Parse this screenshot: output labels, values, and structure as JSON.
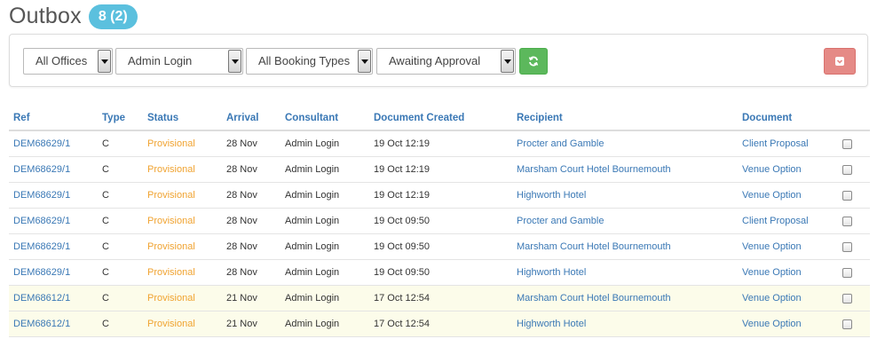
{
  "header": {
    "title": "Outbox",
    "count_badge": "8 (2)"
  },
  "filters": {
    "office": "All Offices",
    "user": "Admin Login",
    "booking_type": "All Booking Types",
    "status": "Awaiting Approval"
  },
  "icons": {
    "refresh": "refresh-icon",
    "export": "archive-download-icon"
  },
  "colors": {
    "badge": "#5bc0de",
    "refresh_button": "#5cb85c",
    "export_button": "#e58a86",
    "link": "#3a78b5",
    "status_provisional": "#f0a330",
    "highlight_row": "#fcfcea"
  },
  "table": {
    "columns": [
      "Ref",
      "Type",
      "Status",
      "Arrival",
      "Consultant",
      "Document Created",
      "Recipient",
      "Document"
    ],
    "rows": [
      {
        "ref": "DEM68629/1",
        "type": "C",
        "status": "Provisional",
        "arrival": "28 Nov",
        "consultant": "Admin Login",
        "created": "19 Oct 12:19",
        "recipient": "Procter and Gamble",
        "document": "Client Proposal",
        "checked": false,
        "highlight": false
      },
      {
        "ref": "DEM68629/1",
        "type": "C",
        "status": "Provisional",
        "arrival": "28 Nov",
        "consultant": "Admin Login",
        "created": "19 Oct 12:19",
        "recipient": "Marsham Court Hotel Bournemouth",
        "document": "Venue Option",
        "checked": false,
        "highlight": false
      },
      {
        "ref": "DEM68629/1",
        "type": "C",
        "status": "Provisional",
        "arrival": "28 Nov",
        "consultant": "Admin Login",
        "created": "19 Oct 12:19",
        "recipient": "Highworth Hotel",
        "document": "Venue Option",
        "checked": false,
        "highlight": false
      },
      {
        "ref": "DEM68629/1",
        "type": "C",
        "status": "Provisional",
        "arrival": "28 Nov",
        "consultant": "Admin Login",
        "created": "19 Oct 09:50",
        "recipient": "Procter and Gamble",
        "document": "Client Proposal",
        "checked": false,
        "highlight": false
      },
      {
        "ref": "DEM68629/1",
        "type": "C",
        "status": "Provisional",
        "arrival": "28 Nov",
        "consultant": "Admin Login",
        "created": "19 Oct 09:50",
        "recipient": "Marsham Court Hotel Bournemouth",
        "document": "Venue Option",
        "checked": false,
        "highlight": false
      },
      {
        "ref": "DEM68629/1",
        "type": "C",
        "status": "Provisional",
        "arrival": "28 Nov",
        "consultant": "Admin Login",
        "created": "19 Oct 09:50",
        "recipient": "Highworth Hotel",
        "document": "Venue Option",
        "checked": false,
        "highlight": false
      },
      {
        "ref": "DEM68612/1",
        "type": "C",
        "status": "Provisional",
        "arrival": "21 Nov",
        "consultant": "Admin Login",
        "created": "17 Oct 12:54",
        "recipient": "Marsham Court Hotel Bournemouth",
        "document": "Venue Option",
        "checked": false,
        "highlight": true
      },
      {
        "ref": "DEM68612/1",
        "type": "C",
        "status": "Provisional",
        "arrival": "21 Nov",
        "consultant": "Admin Login",
        "created": "17 Oct 12:54",
        "recipient": "Highworth Hotel",
        "document": "Venue Option",
        "checked": false,
        "highlight": true
      }
    ]
  }
}
